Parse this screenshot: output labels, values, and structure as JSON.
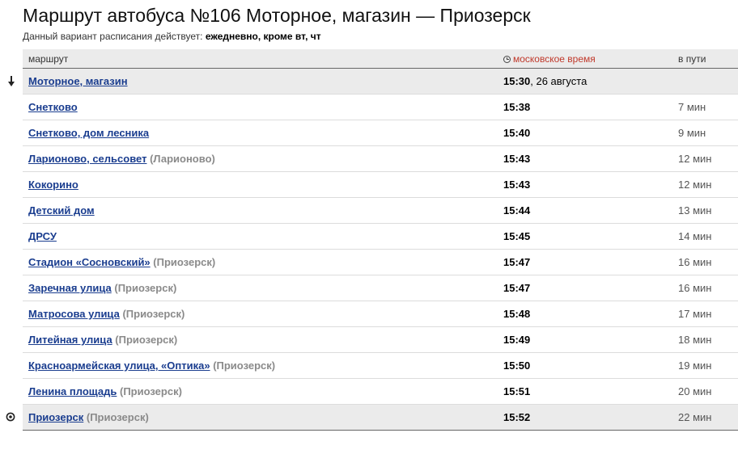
{
  "header": {
    "title": "Маршрут автобуса №106 Моторное, магазин — Приозерск",
    "subtitle_prefix": "Данный вариант расписания действует: ",
    "subtitle_value": "ежедневно, кроме вт, чт"
  },
  "table": {
    "columns": {
      "route": "маршрут",
      "time": "московское время",
      "duration": "в пути"
    },
    "rows": [
      {
        "stop": "Моторное, магазин",
        "town": "",
        "time": "15:30",
        "date": ", 26 августа",
        "duration": ""
      },
      {
        "stop": "Снетково",
        "town": "",
        "time": "15:38",
        "date": "",
        "duration": "7 мин"
      },
      {
        "stop": "Снетково, дом лесника",
        "town": "",
        "time": "15:40",
        "date": "",
        "duration": "9 мин"
      },
      {
        "stop": "Ларионово, сельсовет",
        "town": "(Ларионово)",
        "time": "15:43",
        "date": "",
        "duration": "12 мин"
      },
      {
        "stop": "Кокорино",
        "town": "",
        "time": "15:43",
        "date": "",
        "duration": "12 мин"
      },
      {
        "stop": "Детский дом",
        "town": "",
        "time": "15:44",
        "date": "",
        "duration": "13 мин"
      },
      {
        "stop": "ДРСУ",
        "town": "",
        "time": "15:45",
        "date": "",
        "duration": "14 мин"
      },
      {
        "stop": "Стадион «Сосновский»",
        "town": "(Приозерск)",
        "time": "15:47",
        "date": "",
        "duration": "16 мин"
      },
      {
        "stop": "Заречная улица",
        "town": "(Приозерск)",
        "time": "15:47",
        "date": "",
        "duration": "16 мин"
      },
      {
        "stop": "Матросова улица",
        "town": "(Приозерск)",
        "time": "15:48",
        "date": "",
        "duration": "17 мин"
      },
      {
        "stop": "Литейная улица",
        "town": "(Приозерск)",
        "time": "15:49",
        "date": "",
        "duration": "18 мин"
      },
      {
        "stop": "Красноармейская улица, «Оптика»",
        "town": "(Приозерск)",
        "time": "15:50",
        "date": "",
        "duration": "19 мин"
      },
      {
        "stop": "Ленина площадь",
        "town": "(Приозерск)",
        "time": "15:51",
        "date": "",
        "duration": "20 мин"
      },
      {
        "stop": "Приозерск",
        "town": "(Приозерск)",
        "time": "15:52",
        "date": "",
        "duration": "22 мин"
      }
    ]
  },
  "icons": {
    "start_marker": "arrow-down-icon",
    "end_marker": "target-icon",
    "time_header": "clock-icon"
  },
  "colors": {
    "link": "#1a3d8f",
    "time_header": "#c0392b",
    "row_highlight": "#ebebeb"
  }
}
